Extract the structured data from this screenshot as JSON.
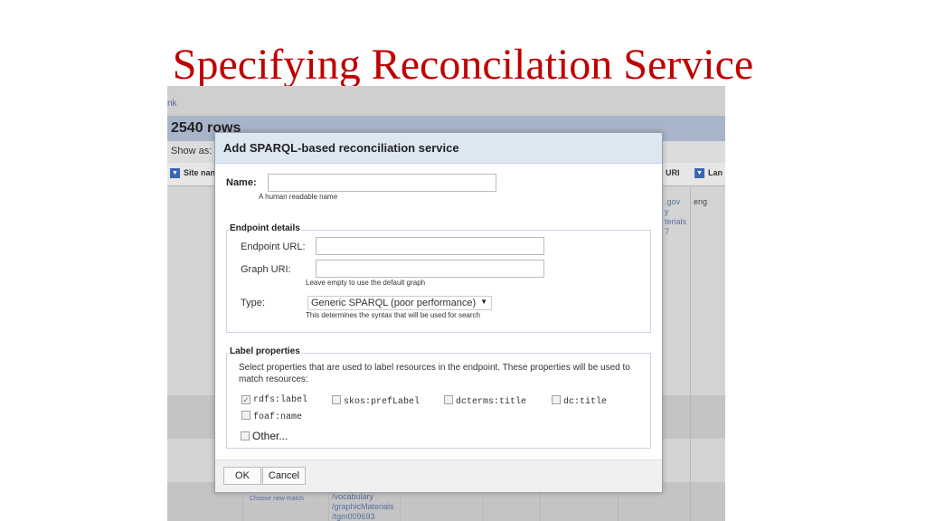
{
  "slide": {
    "title": "Specifying Reconcilation Service"
  },
  "grid": {
    "top_link": "nk",
    "row_count": "2540 rows",
    "show_as": "Show as:",
    "col_site_name": "Site nan",
    "col_uri": "URI",
    "col_lang": "Lan",
    "cell_uri": [
      ".gov",
      "y",
      "terials",
      "7"
    ],
    "cell_lang": "eng",
    "choose_new_match": "Choose new match",
    "bottom_uri": [
      "/vocabulary",
      "/graphicMaterials",
      "/tgm009693"
    ]
  },
  "dialog": {
    "title": "Add SPARQL-based reconciliation service",
    "name_label": "Name:",
    "name_value": "",
    "name_hint": "A human readable name",
    "endpoint_legend": "Endpoint details",
    "endpoint_url_label": "Endpoint URL:",
    "endpoint_url_value": "",
    "graph_uri_label": "Graph URI:",
    "graph_uri_value": "",
    "graph_hint": "Leave empty to use the default graph",
    "type_label": "Type:",
    "type_selected": "Generic SPARQL (poor performance)",
    "type_hint": "This determines the syntax that will be used for search",
    "label_legend": "Label properties",
    "label_desc": "Select properties that are used to label resources in the endpoint. These properties will be used to match resources:",
    "props": [
      {
        "label": "rdfs:label",
        "checked": true
      },
      {
        "label": "skos:prefLabel",
        "checked": false
      },
      {
        "label": "dcterms:title",
        "checked": false
      },
      {
        "label": "dc:title",
        "checked": false
      },
      {
        "label": "foaf:name",
        "checked": false
      }
    ],
    "other_label": "Other...",
    "ok_label": "OK",
    "cancel_label": "Cancel"
  },
  "icons": {
    "checkmark": "check-icon",
    "dropdown": "caret-down-icon",
    "column_menu": "triangle-down-icon"
  }
}
